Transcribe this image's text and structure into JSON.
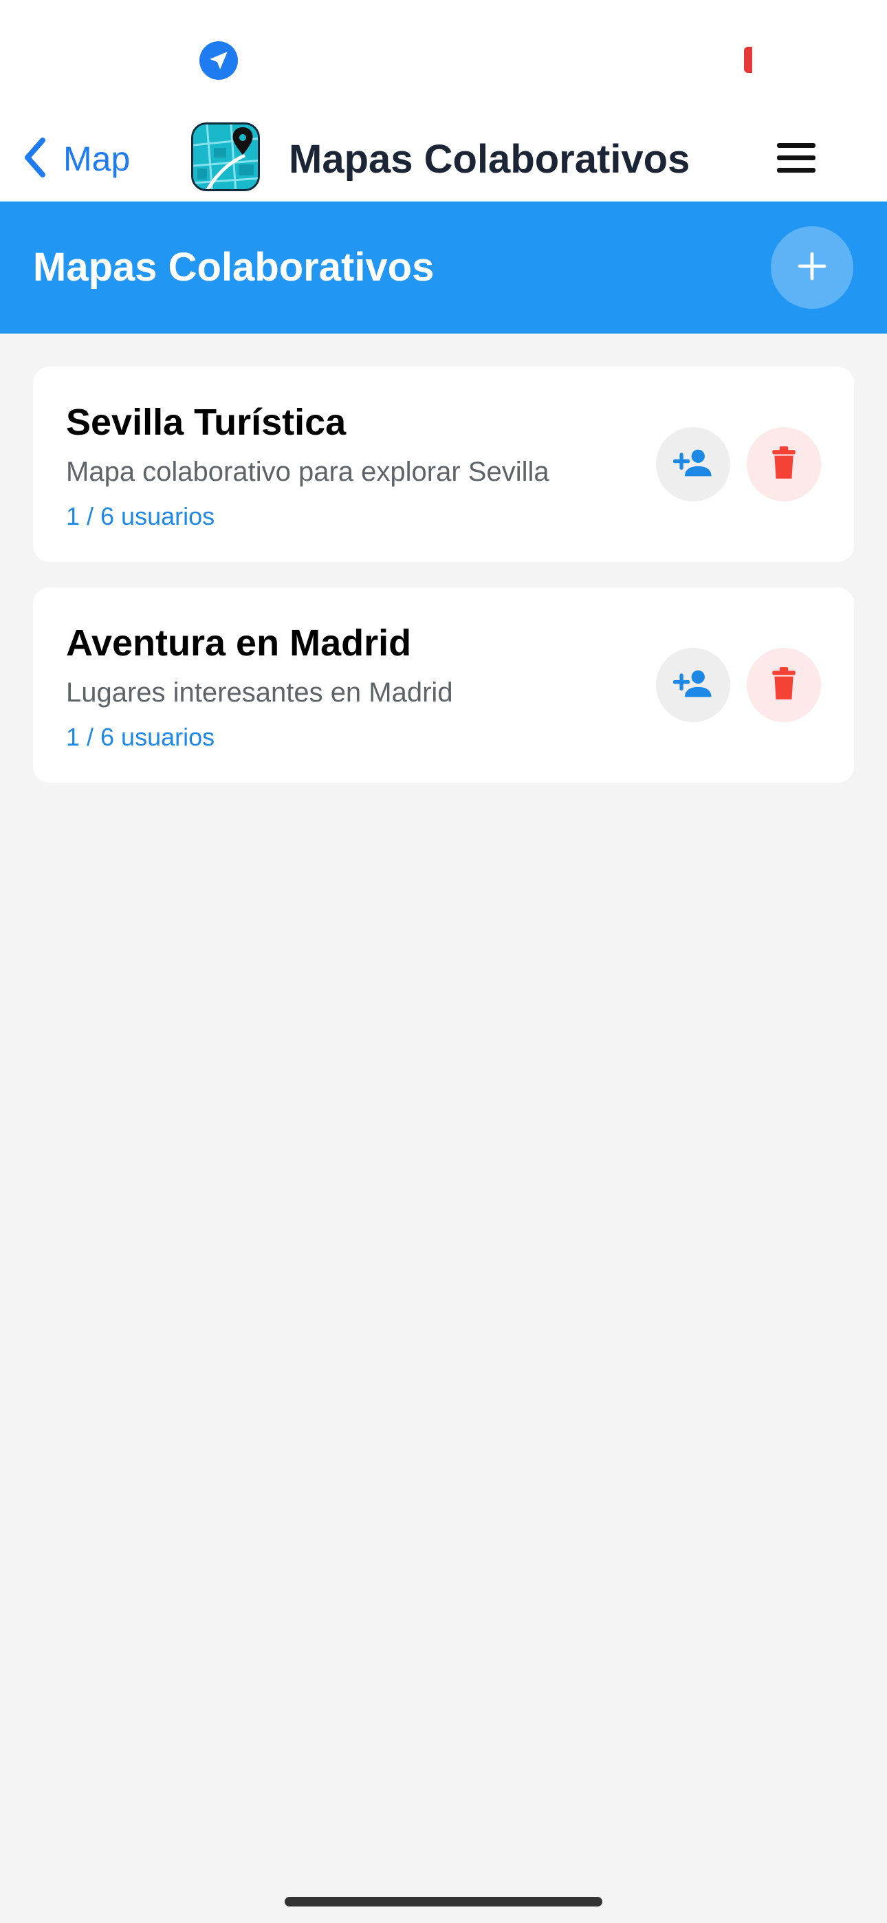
{
  "status_bar": {
    "location_icon": "location-arrow-icon",
    "indicator_color": "#e53935"
  },
  "nav_bar": {
    "back_label": "Map",
    "back_icon": "chevron-left-icon",
    "app_icon": "map-pin-app-icon",
    "title": "Mapas Colaborativos",
    "menu_icon": "hamburger-menu-icon"
  },
  "header": {
    "title": "Mapas Colaborativos",
    "add_icon": "plus-icon",
    "background_color": "#2196f3"
  },
  "maps": [
    {
      "title": "Sevilla Turística",
      "description": "Mapa colaborativo para explorar Sevilla",
      "users": "1 / 6 usuarios",
      "invite_icon": "person-add-icon",
      "delete_icon": "trash-icon"
    },
    {
      "title": "Aventura en Madrid",
      "description": "Lugares interesantes en Madrid",
      "users": "1 / 6 usuarios",
      "invite_icon": "person-add-icon",
      "delete_icon": "trash-icon"
    }
  ],
  "colors": {
    "accent_blue": "#1e88e5",
    "delete_red": "#f44336",
    "delete_bg": "#fde8ea",
    "invite_bg": "#eeeeee"
  }
}
